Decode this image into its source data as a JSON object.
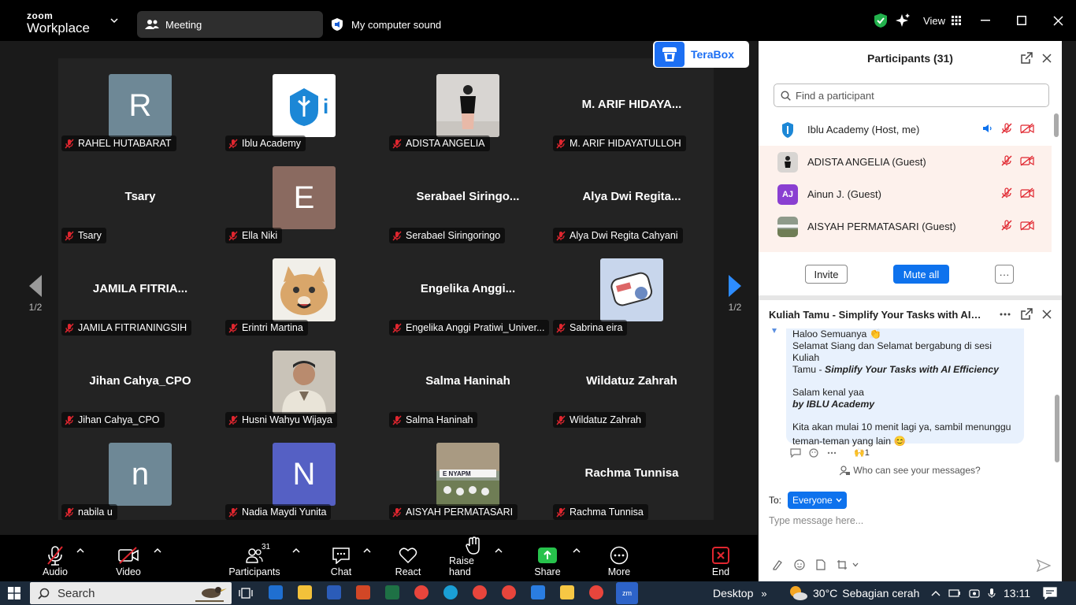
{
  "titlebar": {
    "logo_top": "zoom",
    "logo_bottom": "Workplace",
    "meeting_tab": "Meeting",
    "sound_tab": "My computer sound",
    "view": "View"
  },
  "terabox": {
    "label": "TeraBox"
  },
  "grid": {
    "page_left": "1/2",
    "page_right": "1/2",
    "tiles": [
      {
        "name": "RAHEL HUTABARAT",
        "display": "R",
        "kind": "letter",
        "color": "#6e8896"
      },
      {
        "name": "Iblu Academy",
        "display": "",
        "kind": "logo",
        "color": "#ffffff"
      },
      {
        "name": "ADISTA ANGELIA",
        "display": "",
        "kind": "photo-person",
        "color": "#d8d5d2"
      },
      {
        "name": "M. ARIF HIDAYATULLOH",
        "display": "M. ARIF HIDAYA...",
        "kind": "text",
        "color": ""
      },
      {
        "name": "Tsary",
        "display": "Tsary",
        "kind": "text",
        "color": ""
      },
      {
        "name": "Ella Niki",
        "display": "E",
        "kind": "letter",
        "color": "#8a6a60"
      },
      {
        "name": "Serabael Siringoringo",
        "display": "Serabael  Siringo...",
        "kind": "text",
        "color": ""
      },
      {
        "name": "Alya Dwi Regita Cahyani",
        "display": "Alya Dwi Regita...",
        "kind": "text",
        "color": ""
      },
      {
        "name": "JAMILA FITRIANINGSIH",
        "display": "JAMILA FITRIA...",
        "kind": "text",
        "color": ""
      },
      {
        "name": "Erintri Martina",
        "display": "",
        "kind": "photo-cat",
        "color": "#d9b07a"
      },
      {
        "name": "Engelika Anggi Pratiwi_Univer...",
        "display": "Engelika  Anggi...",
        "kind": "text",
        "color": ""
      },
      {
        "name": "Sabrina eira",
        "display": "",
        "kind": "photo-sticker",
        "color": "#c8d6ec"
      },
      {
        "name": "Jihan Cahya_CPO",
        "display": "Jihan Cahya_CPO",
        "kind": "text",
        "color": ""
      },
      {
        "name": "Husni Wahyu Wijaya",
        "display": "",
        "kind": "photo-man",
        "color": "#c9c3b8"
      },
      {
        "name": "Salma Haninah",
        "display": "Salma Haninah",
        "kind": "text",
        "color": ""
      },
      {
        "name": "Wildatuz Zahrah",
        "display": "Wildatuz Zahrah",
        "kind": "text",
        "color": ""
      },
      {
        "name": "nabila u",
        "display": "n",
        "kind": "letter",
        "color": "#6e8896"
      },
      {
        "name": "Nadia Maydi Yunita",
        "display": "N",
        "kind": "letter",
        "color": "#5560c4"
      },
      {
        "name": "AISYAH PERMATASARI",
        "display": "",
        "kind": "photo-group",
        "color": "#8a8f70"
      },
      {
        "name": "Rachma Tunnisa",
        "display": "Rachma Tunnisa",
        "kind": "text",
        "color": ""
      }
    ]
  },
  "participants": {
    "title": "Participants (31)",
    "search_placeholder": "Find a participant",
    "rows": [
      {
        "name": "Iblu Academy (Host, me)",
        "avatar": "",
        "kind": "host"
      },
      {
        "name": "ADISTA ANGELIA (Guest)",
        "avatar": "",
        "kind": "guest"
      },
      {
        "name": "Ainun J. (Guest)",
        "avatar": "AJ",
        "kind": "guest"
      },
      {
        "name": "AISYAH PERMATASARI (Guest)",
        "avatar": "",
        "kind": "guest"
      }
    ],
    "invite": "Invite",
    "mute_all": "Mute all",
    "more": "···"
  },
  "chat": {
    "title": "Kuliah Tamu - Simplify Your Tasks with AI E...",
    "message": {
      "line1": "Haloo Semuanya 👏",
      "line2": "Selamat Siang dan Selamat bergabung di sesi Kuliah",
      "line3_plain": "Tamu - ",
      "line3_bold": "Simplify Your Tasks with AI Efficiency",
      "line4": "Salam kenal yaa",
      "line5": "by IBLU Academy",
      "line6": "Kita akan mulai 10 menit lagi ya, sambil menunggu",
      "line7": "teman-teman yang lain 😊"
    },
    "reaction": "🙌1",
    "who_can_see": "Who can see your messages?",
    "to_label": "To:",
    "to_value": "Everyone",
    "placeholder": "Type message here..."
  },
  "toolbar": {
    "audio": "Audio",
    "video": "Video",
    "participants": "Participants",
    "participants_count": "31",
    "chat": "Chat",
    "react": "React",
    "raise_hand": "Raise hand",
    "share": "Share",
    "more": "More",
    "end": "End"
  },
  "taskbar": {
    "search": "Search",
    "desktop": "Desktop",
    "weather_temp": "30°C",
    "weather_desc": "Sebagian cerah",
    "time": "13:11"
  },
  "colors": {
    "accent": "#0e72ed",
    "muted_red": "#e0262f",
    "share_green": "#27c24c"
  }
}
